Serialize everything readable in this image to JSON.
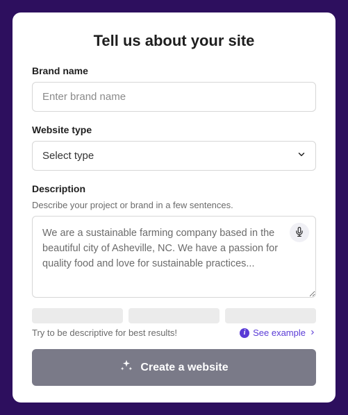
{
  "title": "Tell us about your site",
  "brand": {
    "label": "Brand name",
    "placeholder": "Enter brand name",
    "value": ""
  },
  "website_type": {
    "label": "Website type",
    "selected": "Select type"
  },
  "description": {
    "label": "Description",
    "help": "Describe your project or brand in a few sentences.",
    "value": "We are a sustainable farming company based in the beautiful city of Asheville, NC. We have a passion for quality food and love for sustainable practices..."
  },
  "hint": "Try to be descriptive for best results!",
  "example_link": "See example",
  "cta": "Create a website"
}
